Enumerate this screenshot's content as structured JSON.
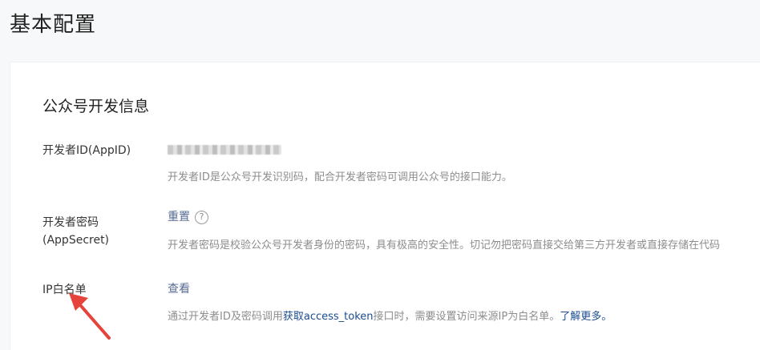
{
  "page": {
    "title": "基本配置"
  },
  "section": {
    "title": "公众号开发信息"
  },
  "app_id": {
    "label": "开发者ID(AppID)",
    "description": "开发者ID是公众号开发识别码，配合开发者密码可调用公众号的接口能力。"
  },
  "app_secret": {
    "label_line1": "开发者密码",
    "label_line2": "(AppSecret)",
    "reset_label": "重置",
    "help_glyph": "?",
    "description": "开发者密码是校验公众号开发者身份的密码，具有极高的安全性。切记勿把密码直接交给第三方开发者或直接存储在代码"
  },
  "ip_whitelist": {
    "label": "IP白名单",
    "view_label": "查看",
    "desc_prefix": "通过开发者ID及密码调用",
    "desc_link": "获取access_token",
    "desc_middle": "接口时，需要设置访问来源IP为白名单。",
    "learn_more": "了解更多。"
  },
  "annotation": {
    "arrow_color": "#e5433c"
  }
}
